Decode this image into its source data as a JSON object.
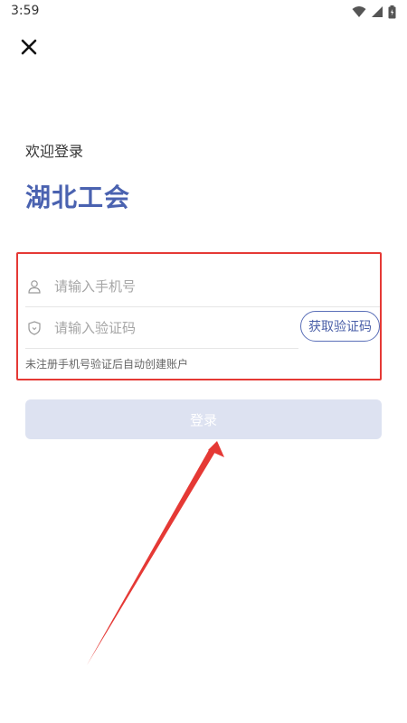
{
  "status_bar": {
    "time": "3:59"
  },
  "header": {
    "close_icon": "close-icon"
  },
  "welcome_text": "欢迎登录",
  "app_title": "湖北工会",
  "form": {
    "phone": {
      "placeholder": "请输入手机号",
      "value": "",
      "icon": "user-icon"
    },
    "code": {
      "placeholder": "请输入验证码",
      "value": "",
      "icon": "shield-icon"
    },
    "get_code_label": "获取验证码",
    "hint": "未注册手机号验证后自动创建账户"
  },
  "login_button": {
    "label": "登录",
    "enabled": false
  },
  "colors": {
    "accent": "#4a62b0",
    "highlight": "#e53935",
    "login_disabled_bg": "#dde2f1"
  }
}
